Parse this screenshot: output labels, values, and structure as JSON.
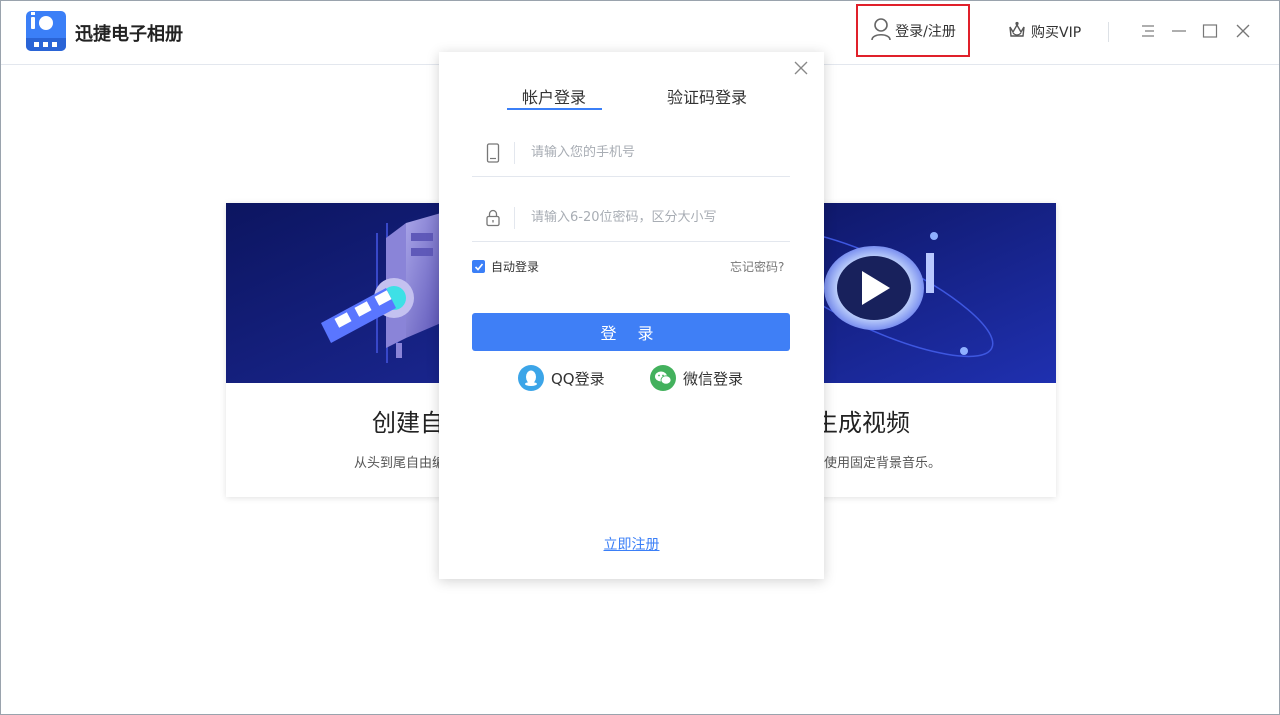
{
  "app": {
    "title": "迅捷电子相册"
  },
  "header": {
    "login_label": "登录/注册",
    "vip_label": "购买VIP"
  },
  "cards": [
    {
      "heading": "创建自定义",
      "desc": "从头到尾自由编辑，自定义"
    },
    {
      "heading": "速生成视频",
      "desc": "选择动作，使用固定背景音乐。"
    }
  ],
  "modal": {
    "tabs": [
      "帐户登录",
      "验证码登录"
    ],
    "phone_placeholder": "请输入您的手机号",
    "password_placeholder": "请输入6-20位密码，区分大小写",
    "auto_login_label": "自动登录",
    "auto_login_checked": true,
    "forgot_label": "忘记密码?",
    "login_button": "登 录",
    "qq_label": "QQ登录",
    "wechat_label": "微信登录",
    "register_label": "立即注册"
  },
  "colors": {
    "accent": "#3f7ff6",
    "highlight_border": "#e0202a",
    "qq": "#3ca5e8",
    "wechat": "#43b15d"
  }
}
